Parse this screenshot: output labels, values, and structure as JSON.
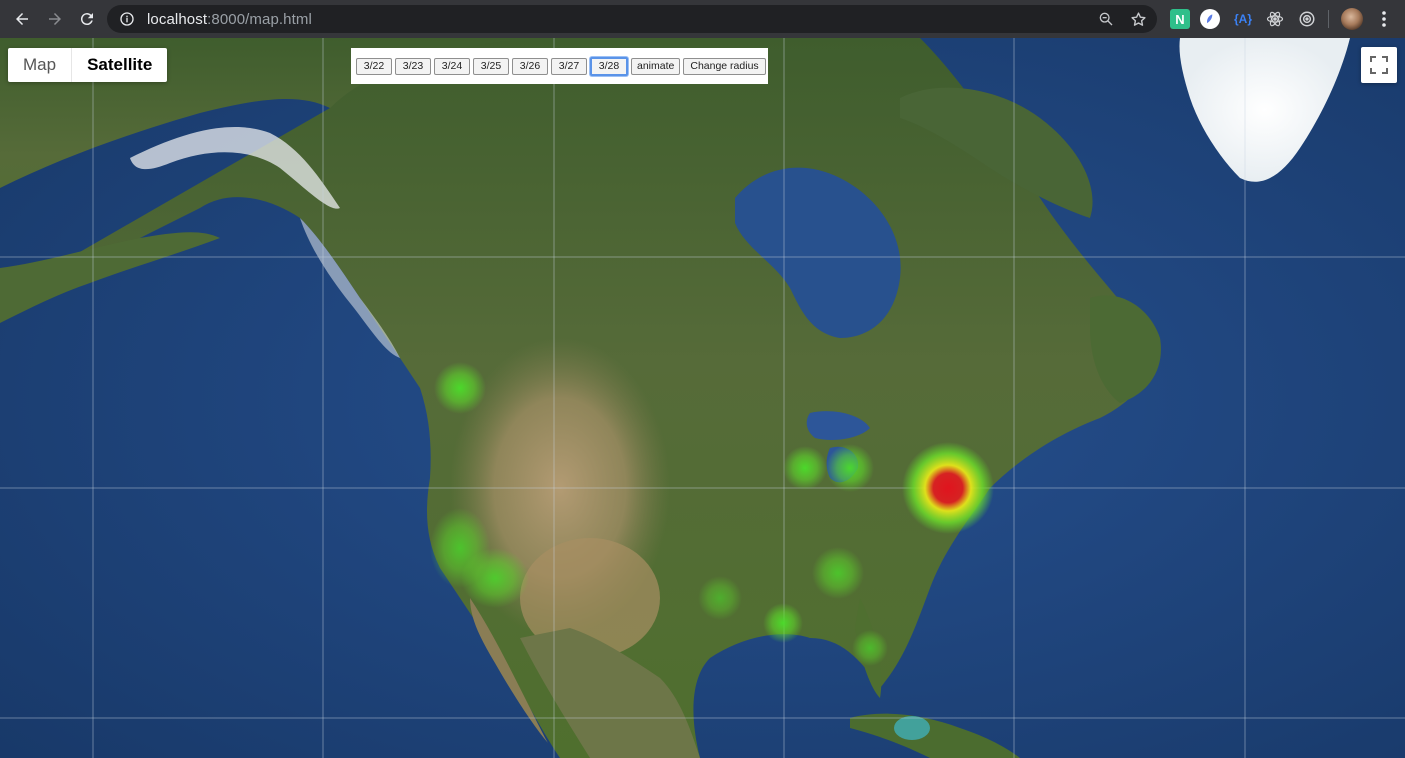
{
  "browser": {
    "url_host": "localhost",
    "url_path": ":8000/map.html",
    "icons": {
      "back": "arrow-left",
      "forward": "arrow-right",
      "reload": "reload",
      "info": "info-circle",
      "zoom": "magnifier",
      "bookmark": "star",
      "menu": "vertical-dots"
    },
    "extensions": {
      "n_label": "N",
      "a_label": "{A}"
    }
  },
  "map": {
    "type_control": {
      "map_label": "Map",
      "satellite_label": "Satellite",
      "selected": "Satellite"
    },
    "controls": {
      "dates": [
        "3/22",
        "3/23",
        "3/24",
        "3/25",
        "3/26",
        "3/27",
        "3/28"
      ],
      "selected_date": "3/28",
      "animate_label": "animate",
      "radius_label": "Change radius"
    },
    "heatmap_colors": {
      "low": "#4ade2a",
      "mid": "#e6e61a",
      "high": "#e0141e"
    }
  }
}
